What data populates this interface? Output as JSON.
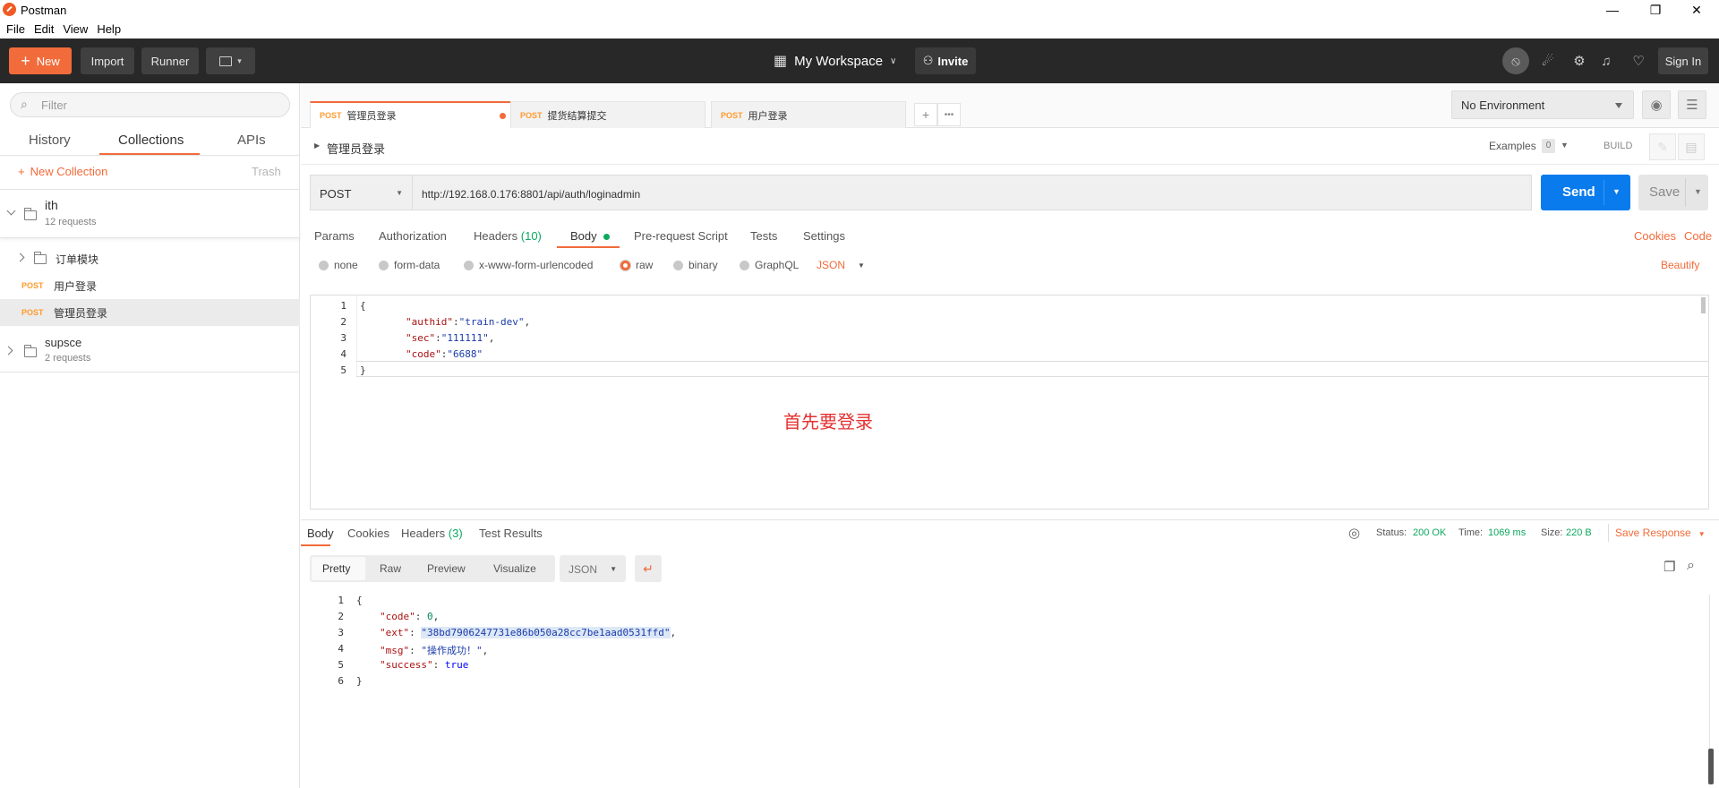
{
  "window": {
    "title": "Postman"
  },
  "menu": [
    "File",
    "Edit",
    "View",
    "Help"
  ],
  "header": {
    "new_label": "New",
    "import_label": "Import",
    "runner_label": "Runner",
    "workspace_label": "My Workspace",
    "invite_label": "Invite",
    "signin_label": "Sign In"
  },
  "sidebar": {
    "filter_placeholder": "Filter",
    "tabs": [
      "History",
      "Collections",
      "APIs"
    ],
    "new_collection": "New Collection",
    "trash": "Trash",
    "collections": [
      {
        "name": "ith",
        "count": "12 requests"
      },
      {
        "name": "supsce",
        "count": "2 requests"
      }
    ],
    "folder": "订单模块",
    "requests": [
      {
        "method": "POST",
        "name": "用户登录"
      },
      {
        "method": "POST",
        "name": "管理员登录"
      }
    ]
  },
  "tabs": [
    {
      "method": "POST",
      "name": "管理员登录"
    },
    {
      "method": "POST",
      "name": "提货结算提交"
    },
    {
      "method": "POST",
      "name": "用户登录"
    }
  ],
  "environment": {
    "selected": "No Environment"
  },
  "request": {
    "name": "管理员登录",
    "examples_label": "Examples",
    "examples_count": "0",
    "build_label": "BUILD",
    "method": "POST",
    "url": "http://192.168.0.176:8801/api/auth/loginadmin",
    "send_label": "Send",
    "save_label": "Save",
    "tabs": [
      "Params",
      "Authorization",
      "Headers",
      "Body",
      "Pre-request Script",
      "Tests",
      "Settings"
    ],
    "headers_count": "(10)",
    "cookies_link": "Cookies",
    "code_link": "Code",
    "body_types": [
      "none",
      "form-data",
      "x-www-form-urlencoded",
      "raw",
      "binary",
      "GraphQL"
    ],
    "body_format": "JSON",
    "beautify": "Beautify",
    "annotation": "首先要登录",
    "body_lines": [
      {
        "n": "1",
        "text": "{"
      },
      {
        "n": "2",
        "key": "\"authid\"",
        "val": "\"train-dev\""
      },
      {
        "n": "3",
        "key": "\"sec\"",
        "val": "\"111111\""
      },
      {
        "n": "4",
        "key": "\"code\"",
        "val": "\"6688\""
      },
      {
        "n": "5",
        "text": "}"
      }
    ]
  },
  "response": {
    "tabs": [
      "Body",
      "Cookies",
      "Headers",
      "Test Results"
    ],
    "headers_count": "(3)",
    "status_label": "Status:",
    "status_value": "200 OK",
    "time_label": "Time:",
    "time_value": "1069 ms",
    "size_label": "Size:",
    "size_value": "220 B",
    "save_response": "Save Response",
    "views": [
      "Pretty",
      "Raw",
      "Preview",
      "Visualize"
    ],
    "format": "JSON",
    "lines": [
      {
        "n": "1",
        "text": "{"
      },
      {
        "n": "2",
        "key": "\"code\"",
        "val": "0",
        "type": "num"
      },
      {
        "n": "3",
        "key": "\"ext\"",
        "val": "\"38bd7906247731e86b050a28cc7be1aad0531ffd\"",
        "type": "str"
      },
      {
        "n": "4",
        "key": "\"msg\"",
        "val": "\"操作成功！\"",
        "type": "str"
      },
      {
        "n": "5",
        "key": "\"success\"",
        "val": "true",
        "type": "kw"
      },
      {
        "n": "6",
        "text": "}"
      }
    ]
  },
  "colors": {
    "accent": "#f26b3a",
    "send": "#097bed",
    "header_bg": "#282828",
    "status_ok": "#0ca95e"
  }
}
